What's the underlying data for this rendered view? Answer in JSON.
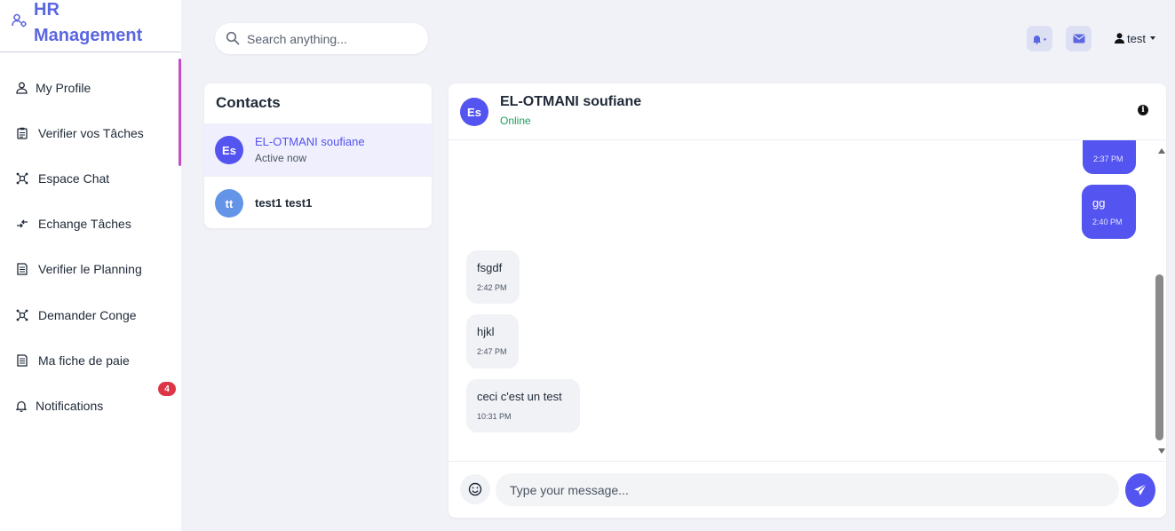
{
  "brand": {
    "title": "HR Management",
    "icon": "user-gear-icon"
  },
  "sidebar": {
    "items": [
      {
        "label": "My Profile",
        "icon": "user-icon"
      },
      {
        "label": "Verifier vos Tâches",
        "icon": "clipboard-icon"
      },
      {
        "label": "Espace Chat",
        "icon": "chat-network-icon"
      },
      {
        "label": "Echange Tâches",
        "icon": "exchange-arrows-icon"
      },
      {
        "label": "Verifier le Planning",
        "icon": "calendar-doc-icon"
      },
      {
        "label": "Demander Conge",
        "icon": "leave-request-icon"
      },
      {
        "label": "Ma fiche de paie",
        "icon": "payslip-icon"
      },
      {
        "label": "Notifications",
        "icon": "bell-icon"
      }
    ],
    "notifications_badge": "4"
  },
  "search": {
    "placeholder": "Search anything..."
  },
  "topbar": {
    "user_name": "test"
  },
  "contacts": {
    "title": "Contacts",
    "items": [
      {
        "initials": "Es",
        "name": "EL-OTMANI soufiane",
        "status": "Active now",
        "active": true
      },
      {
        "initials": "tt",
        "name": "test1 test1",
        "status": "",
        "active": false
      }
    ]
  },
  "chat": {
    "initials": "Es",
    "name": "EL-OTMANI soufiane",
    "presence": "Online",
    "messages": [
      {
        "direction": "out",
        "text": "",
        "time": "2:37 PM"
      },
      {
        "direction": "out",
        "text": "gg",
        "time": "2:40 PM"
      },
      {
        "direction": "in",
        "text": "fsgdf",
        "time": "2:42 PM"
      },
      {
        "direction": "in",
        "text": "hjkl",
        "time": "2:47 PM"
      },
      {
        "direction": "in",
        "text": "ceci c'est un test",
        "time": "10:31 PM"
      }
    ],
    "input_placeholder": "Type your message..."
  },
  "colors": {
    "brand": "#5b67e0",
    "accent_bar": "#c44dc7",
    "outgoing_bubble": "#5454f0",
    "badge": "#dc3545",
    "online": "#1e9e5c"
  }
}
